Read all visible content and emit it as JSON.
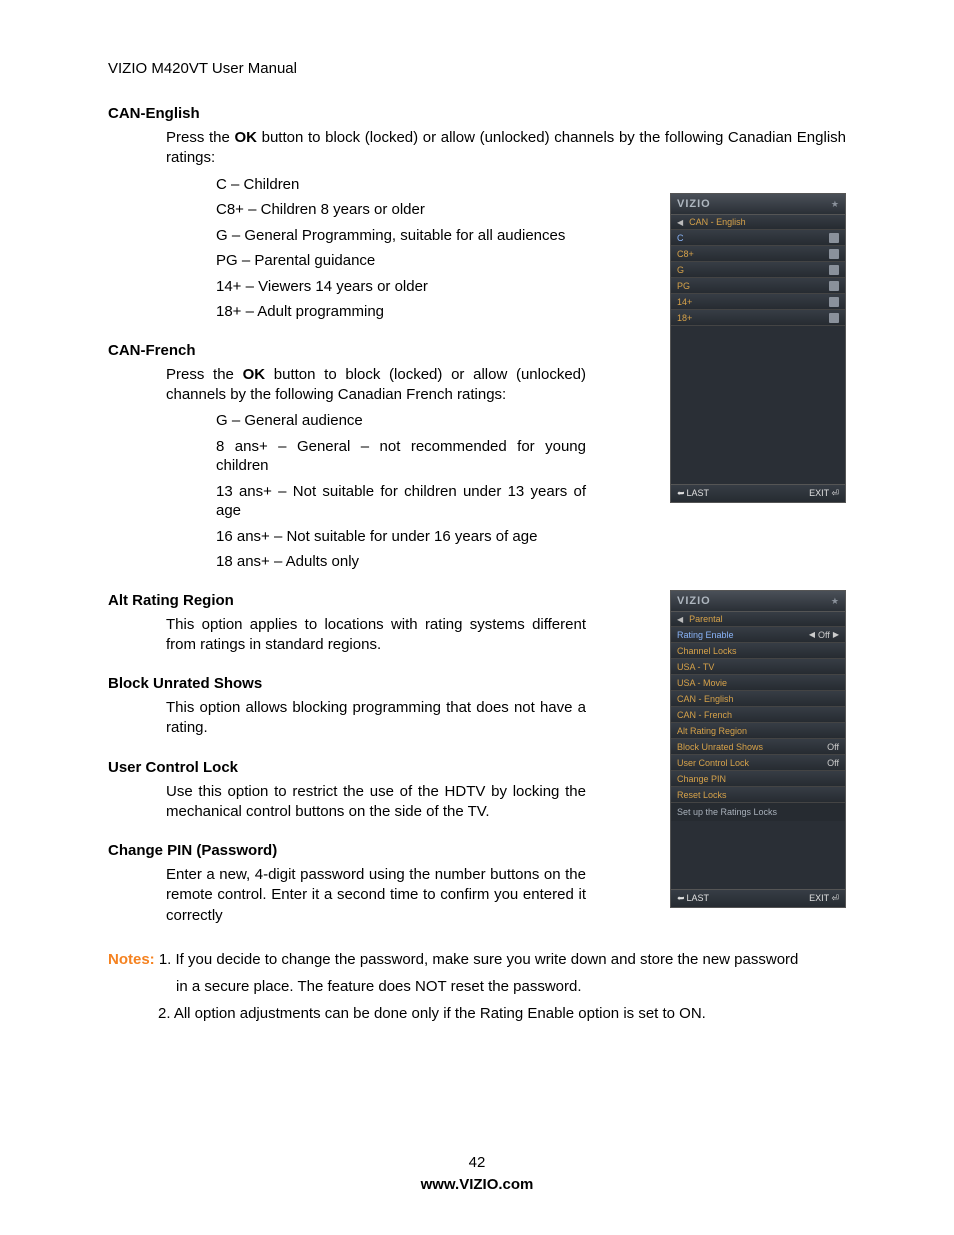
{
  "header": "VIZIO M420VT User Manual",
  "page_number": "42",
  "footer_url": "www.VIZIO.com",
  "ok": "OK",
  "sections": {
    "can_en": {
      "title": "CAN-English",
      "p_a": "Press the ",
      "p_b": " button to block (locked) or allow (unlocked) channels by the following Canadian English ratings:",
      "ratings": [
        "C – Children",
        "C8+ – Children 8 years or older",
        "G – General Programming, suitable for all audiences",
        "PG – Parental guidance",
        "14+ – Viewers 14 years or older",
        "18+ – Adult programming"
      ]
    },
    "can_fr": {
      "title": "CAN-French",
      "p_a": "Press the ",
      "p_b": " button to block (locked) or allow (unlocked) channels by the following Canadian French ratings:",
      "ratings": [
        "G – General audience",
        "8 ans+ – General – not recommended for young children",
        "13 ans+ – Not suitable for children under 13 years of age",
        "16 ans+ – Not suitable for under 16 years of age",
        "18 ans+ – Adults only"
      ]
    },
    "alt": {
      "title": "Alt Rating Region",
      "p": "This option applies to locations with rating systems different from ratings in standard regions."
    },
    "block": {
      "title": "Block Unrated Shows",
      "p": "This option allows blocking programming that does not have a rating."
    },
    "user_lock": {
      "title": "User Control Lock",
      "p": "Use this option to restrict the use of the HDTV by locking the mechanical control buttons on the side of the TV."
    },
    "change_pin": {
      "title": "Change PIN (Password)",
      "p": "Enter a new, 4-digit password using the number buttons on the remote control. Enter it a second time to confirm you entered it correctly"
    }
  },
  "notes": {
    "label": "Notes:",
    "line1": " 1. If you decide to change the password, make sure you   write down and store the new password",
    "line2": "in a secure place. The                       feature does NOT reset the password.",
    "line3": "2. All option adjustments can be done only if the Rating Enable option is set to ON."
  },
  "osd": {
    "logo": "VIZIO",
    "last": "LAST",
    "exit": "EXIT",
    "off": "Off",
    "screen1": {
      "crumb": "CAN - English",
      "rows": [
        "C",
        "C8+",
        "G",
        "PG",
        "14+",
        "18+"
      ]
    },
    "screen2": {
      "crumb": "Parental",
      "rows": [
        {
          "label": "Rating Enable",
          "val": "Off",
          "arrows": true
        },
        {
          "label": "Channel Locks"
        },
        {
          "label": "USA - TV"
        },
        {
          "label": "USA - Movie"
        },
        {
          "label": "CAN - English"
        },
        {
          "label": "CAN - French"
        },
        {
          "label": "Alt Rating Region"
        },
        {
          "label": "Block Unrated Shows",
          "val": "Off"
        },
        {
          "label": "User Control Lock",
          "val": "Off"
        },
        {
          "label": "Change PIN"
        },
        {
          "label": "Reset Locks"
        }
      ],
      "hint": "Set up the Ratings Locks"
    }
  }
}
